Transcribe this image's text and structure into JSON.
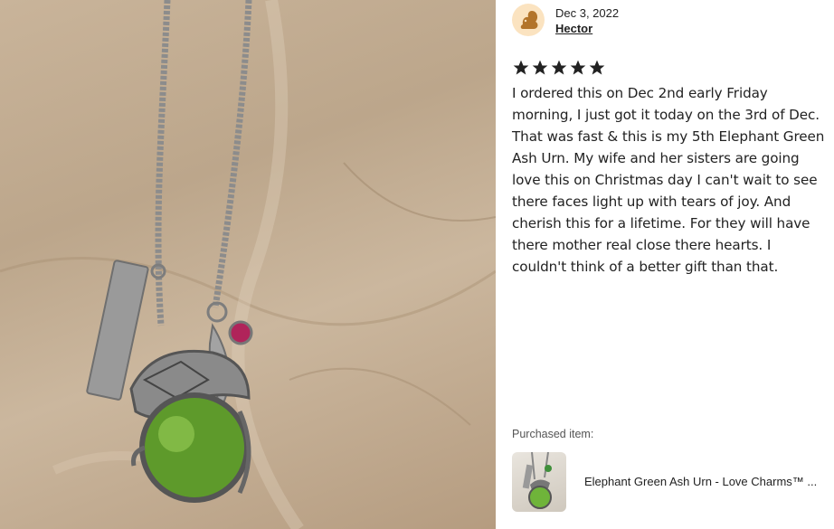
{
  "review": {
    "date": "Dec 3, 2022",
    "author": "Hector",
    "rating": 5,
    "text": "I ordered this on Dec 2nd early Friday morning, I just got it today on the 3rd of Dec. That was fast & this is my 5th Elephant Green Ash Urn. My wife and her sisters are going love this on Christmas day I can't wait to see there faces light up with tears of joy. And cherish this for a lifetime. For they will have there mother real close there hearts. I couldn't think of a better gift than that."
  },
  "purchased": {
    "label": "Purchased item:",
    "title": "Elephant Green Ash Urn - Love Charms™ ..."
  },
  "colors": {
    "star": "#222222",
    "avatar_bg": "#fbe3c0",
    "avatar_icon": "#b3742a"
  },
  "icons": {
    "avatar": "squirrel-avatar-icon",
    "rating": "star-icon"
  }
}
